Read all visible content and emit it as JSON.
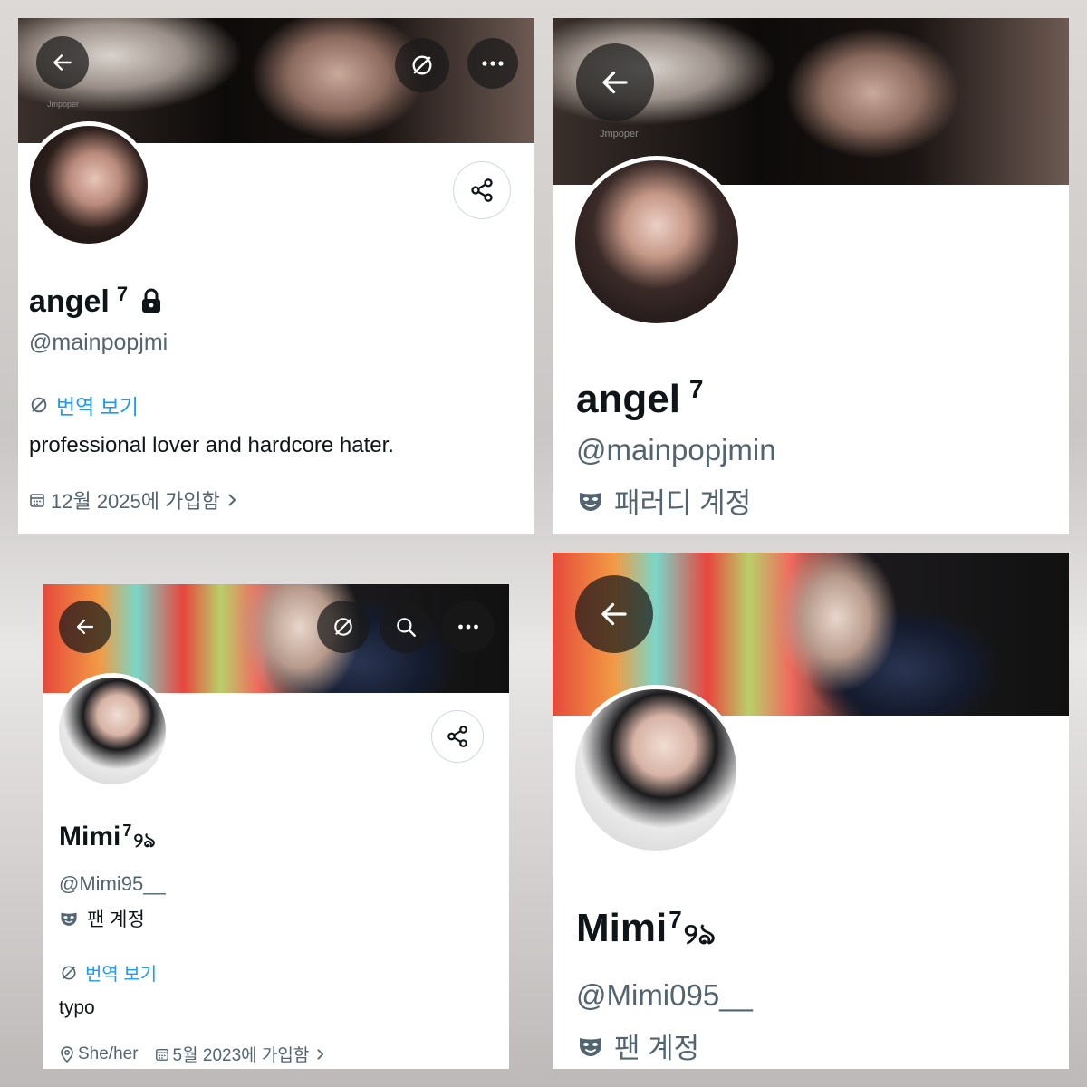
{
  "panels": {
    "top_left": {
      "name": "angel",
      "name_sup": "7",
      "handle": "@mainpopjmi",
      "translate_label": "번역 보기",
      "bio": "professional lover and hardcore hater.",
      "joined": "12월 2025에 가입함",
      "banner_watermark": "Jmpoper"
    },
    "top_right": {
      "name": "angel",
      "name_sup": "7",
      "handle": "@mainpopjmin",
      "account_label": "패러디 계정",
      "banner_watermark": "Jmpoper"
    },
    "bottom_left": {
      "name": "Mimi",
      "name_sup": "7",
      "name_suffix": "୨ঌ",
      "handle": "@Mimi95__",
      "account_label": "팬 계정",
      "translate_label": "번역 보기",
      "bio": "typo",
      "location": "She/her",
      "joined": "5월 2023에 가입함"
    },
    "bottom_right": {
      "name": "Mimi",
      "name_sup": "7",
      "name_suffix": "୨ঌ",
      "handle": "@Mimi095__",
      "account_label": "팬 계정"
    }
  },
  "icons": {
    "back": "back-arrow-icon",
    "translate": "translate-icon",
    "more": "more-icon",
    "search": "search-icon",
    "share": "share-icon",
    "lock": "lock-icon",
    "calendar": "calendar-icon",
    "location": "location-icon",
    "mask": "mask-icon",
    "chevron": "chevron-right-icon"
  },
  "colors": {
    "link": "#1d9bf0",
    "muted": "#536471",
    "text": "#0f1419"
  }
}
